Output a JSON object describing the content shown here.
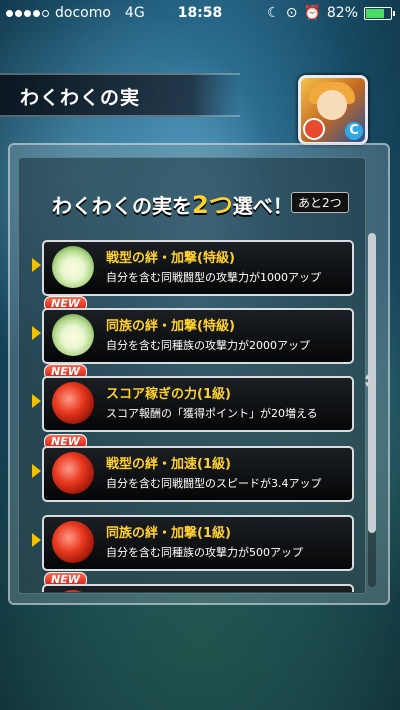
{
  "status_bar": {
    "carrier": "docomo",
    "network": "4G",
    "time": "18:58",
    "battery": "82%",
    "battery_level": 0.82,
    "signal_bars": 4,
    "colors": {
      "battery_fill": "#4cd964"
    }
  },
  "header": {
    "title": "わくわくの実"
  },
  "prompt": {
    "text_before": "わくわくの実を",
    "count": "2つ",
    "text_after": "選べ！",
    "remaining": "あと2つ"
  },
  "list": {
    "items": [
      {
        "new": false,
        "new_label": "",
        "icon": "lotus-fruit-icon",
        "name": "戦型の絆・加撃(特級)",
        "desc": "自分を含む同戦闘型の攻撃力が1000アップ"
      },
      {
        "new": true,
        "new_label": "NEW",
        "icon": "lotus-fruit-icon",
        "name": "同族の絆・加撃(特級)",
        "desc": "自分を含む同種族の攻撃力が2000アップ"
      },
      {
        "new": true,
        "new_label": "NEW",
        "icon": "red-fruit-icon",
        "name": "スコア稼ぎの力(1級)",
        "desc": "スコア報酬の「獲得ポイント」が20増える"
      },
      {
        "new": true,
        "new_label": "NEW",
        "icon": "red-fruit-icon",
        "name": "戦型の絆・加速(1級)",
        "desc": "自分を含む同戦闘型のスピードが3.4アップ"
      },
      {
        "new": false,
        "new_label": "",
        "icon": "red-fruit-icon",
        "name": "同族の絆・加撃(1級)",
        "desc": "自分を含む同種族の攻撃力が500アップ"
      },
      {
        "new": true,
        "new_label": "NEW",
        "icon": "red-fruit-icon",
        "name": "",
        "desc": ""
      }
    ]
  },
  "colors": {
    "accent_yellow": "#ffd12e",
    "new_badge": "#c71b10"
  }
}
